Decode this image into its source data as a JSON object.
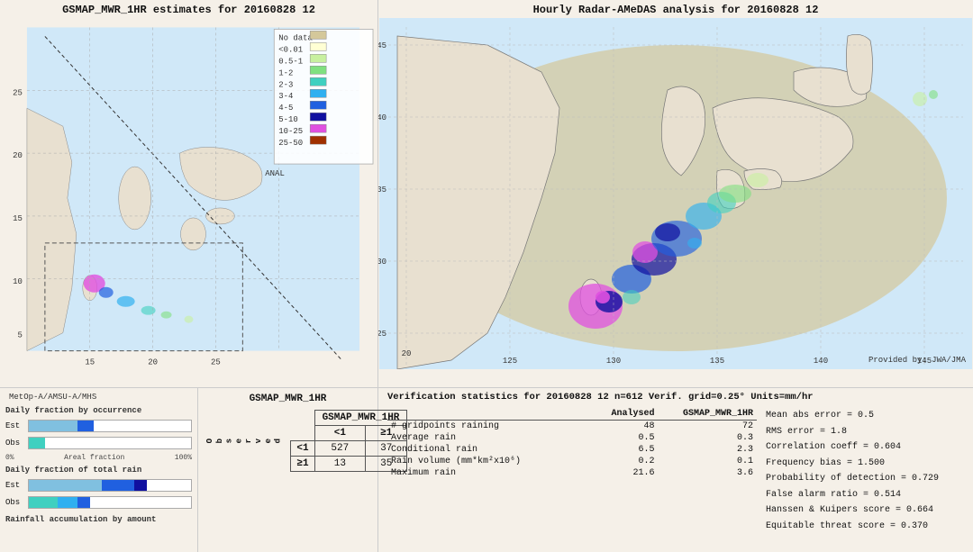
{
  "left_map": {
    "title": "GSMAP_MWR_1HR estimates for 20160828 12",
    "satellite_label": "MetOp-A/AMSU-A/MHS",
    "anal_label": "ANAL",
    "axis_x": [
      "15",
      "20",
      "25"
    ],
    "axis_y": [
      "25",
      "20",
      "15",
      "10",
      "5"
    ]
  },
  "right_map": {
    "title": "Hourly Radar-AMeDAS analysis for 20160828 12",
    "provided_by": "Provided by: JWA/JMA",
    "axis_x": [
      "125",
      "130",
      "135",
      "140",
      "145"
    ],
    "axis_y": [
      "45",
      "40",
      "35",
      "30",
      "25",
      "20"
    ]
  },
  "legend": {
    "items": [
      {
        "label": "No data",
        "color": "#d4c89a"
      },
      {
        "label": "<0.01",
        "color": "#ffffd4"
      },
      {
        "label": "0.5-1",
        "color": "#c8f0a0"
      },
      {
        "label": "1-2",
        "color": "#80e080"
      },
      {
        "label": "2-3",
        "color": "#40d0c0"
      },
      {
        "label": "3-4",
        "color": "#30b0f0"
      },
      {
        "label": "4-5",
        "color": "#2060e0"
      },
      {
        "label": "5-10",
        "color": "#1010a0"
      },
      {
        "label": "10-25",
        "color": "#e050e0"
      },
      {
        "label": "25-50",
        "color": "#a03000"
      }
    ]
  },
  "charts": {
    "chart1_title": "Daily fraction by occurrence",
    "chart2_title": "Daily fraction of total rain",
    "chart3_title": "Rainfall accumulation by amount",
    "x_axis_label": "Areal fraction",
    "x_axis_start": "0%",
    "x_axis_end": "100%",
    "est_label": "Est",
    "obs_label": "Obs"
  },
  "contingency": {
    "title": "GSMAP_MWR_1HR",
    "header_row": [
      "",
      "<1",
      "≥1"
    ],
    "row1_label": "<1",
    "row1_vals": [
      "527",
      "37"
    ],
    "row2_label": "≥1",
    "row2_vals": [
      "13",
      "35"
    ],
    "obs_label": "O\nb\ns\ne\nr\nv\ne\nd"
  },
  "verification": {
    "title": "Verification statistics for 20160828 12  n=612  Verif. grid=0.25°  Units=mm/hr",
    "col_headers": [
      "",
      "Analysed",
      "GSMAP_MWR_1HR"
    ],
    "divider": "------------------------------------------------------------",
    "rows": [
      {
        "label": "# gridpoints raining",
        "analysed": "48",
        "gsmap": "72"
      },
      {
        "label": "Average rain",
        "analysed": "0.5",
        "gsmap": "0.3"
      },
      {
        "label": "Conditional rain",
        "analysed": "6.5",
        "gsmap": "2.3"
      },
      {
        "label": "Rain volume (mm*km²x10⁶)",
        "analysed": "0.2",
        "gsmap": "0.1"
      },
      {
        "label": "Maximum rain",
        "analysed": "21.6",
        "gsmap": "3.6"
      }
    ],
    "stats": [
      "Mean abs error = 0.5",
      "RMS error = 1.8",
      "Correlation coeff = 0.604",
      "Frequency bias = 1.500",
      "Probability of detection = 0.729",
      "False alarm ratio = 0.514",
      "Hanssen & Kuipers score = 0.664",
      "Equitable threat score = 0.370"
    ]
  }
}
